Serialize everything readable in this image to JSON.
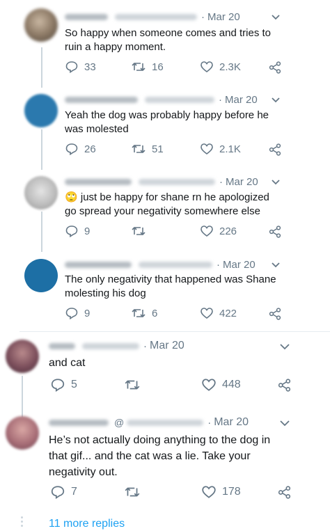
{
  "colors": {
    "accent": "#1da1f2",
    "muted": "#657786",
    "text": "#14171a",
    "line": "#ccd6dd"
  },
  "replies": [
    {
      "date": "Mar 20",
      "text_lines": [
        "So happy when someone comes and tries to",
        "ruin a happy moment."
      ],
      "reply_count": "33",
      "retweet_count": "16",
      "like_count": "2.3K"
    },
    {
      "date": "Mar 20",
      "text_lines": [
        "Yeah the dog was probably happy before he",
        "was molested"
      ],
      "reply_count": "26",
      "retweet_count": "51",
      "like_count": "2.1K"
    },
    {
      "date": "Mar 20",
      "emoji": "🙄",
      "text_lines": [
        "just be happy for shane rn he apologized",
        "go spread your negativity somewhere else"
      ],
      "reply_count": "9",
      "retweet_count": "",
      "like_count": "226"
    },
    {
      "date": "Mar 20",
      "text_lines": [
        "The only negativity that happened was Shane",
        "molesting his dog"
      ],
      "reply_count": "9",
      "retweet_count": "6",
      "like_count": "422"
    },
    {
      "date": "Mar 20",
      "text_lines": [
        "and cat"
      ],
      "reply_count": "5",
      "retweet_count": "",
      "like_count": "448"
    },
    {
      "date": "Mar 20",
      "handle_at": "@",
      "text_lines": [
        "He’s not actually doing anything to the dog in",
        "that gif... and the cat was a lie. Take your",
        "negativity out."
      ],
      "reply_count": "7",
      "retweet_count": "",
      "like_count": "178"
    }
  ],
  "more_replies": "11 more replies",
  "icons": [
    "reply-icon",
    "retweet-icon",
    "like-icon",
    "share-icon",
    "chevron-down-icon"
  ]
}
